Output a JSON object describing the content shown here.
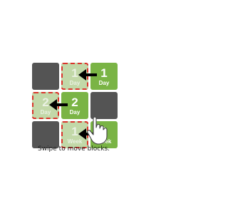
{
  "board": {
    "rows": [
      [
        {
          "kind": "empty"
        },
        {
          "kind": "ghost",
          "num": "1",
          "unit": "Day"
        },
        {
          "kind": "green",
          "num": "1",
          "unit": "Day"
        }
      ],
      [
        {
          "kind": "ghost",
          "num": "2",
          "unit": "Day"
        },
        {
          "kind": "green",
          "num": "2",
          "unit": "Day"
        },
        {
          "kind": "empty"
        }
      ],
      [
        {
          "kind": "empty"
        },
        {
          "kind": "ghost",
          "num": "1",
          "unit": "Week"
        },
        {
          "kind": "green",
          "num": "1",
          "unit": "Week"
        }
      ]
    ],
    "arrow_icon": "left-arrow-icon",
    "hand_icon": "swipe-hand-icon"
  },
  "colors": {
    "empty": "#545454",
    "tile": "#7ab445",
    "ghost": "#c2d8a8",
    "ghost_border": "#d9342b",
    "arrow": "#000000"
  },
  "caption": "Swipe to move blocks."
}
